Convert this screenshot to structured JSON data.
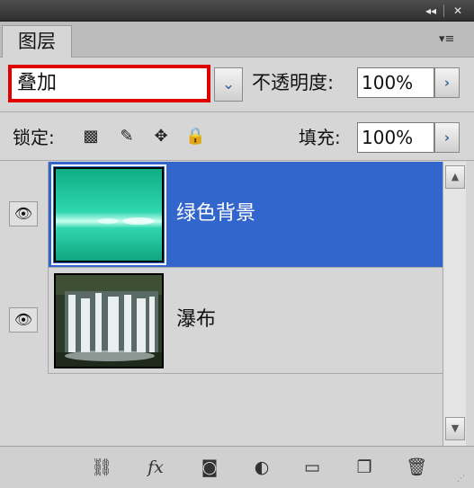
{
  "titlebar": {
    "collapse_glyph": "◂◂",
    "close_glyph": "✕"
  },
  "tabs": [
    {
      "label": "图层"
    }
  ],
  "panel_menu_glyph": "▾≡",
  "blend": {
    "value": "叠加",
    "dropdown_glyph": "⌄"
  },
  "opacity": {
    "label": "不透明度:",
    "value": "100%",
    "arrow_glyph": "›"
  },
  "lock": {
    "label": "锁定:",
    "icons": [
      {
        "name": "lock-transparent-pixels-icon",
        "glyph": "▩"
      },
      {
        "name": "lock-image-pixels-icon",
        "glyph": "✎"
      },
      {
        "name": "lock-position-icon",
        "glyph": "✥"
      },
      {
        "name": "lock-all-icon",
        "glyph": "🔒"
      }
    ]
  },
  "fill": {
    "label": "填充:",
    "value": "100%",
    "arrow_glyph": "›"
  },
  "layers": [
    {
      "name": "绿色背景",
      "visible": true,
      "selected": true,
      "thumbnail": "teal-gradient"
    },
    {
      "name": "瀑布",
      "visible": true,
      "selected": false,
      "thumbnail": "waterfall-photo"
    }
  ],
  "eye_glyph": "👁",
  "scrollbar": {
    "up_glyph": "▲",
    "down_glyph": "▼"
  },
  "bottom_toolbar": [
    {
      "name": "link-layers-icon",
      "glyph": "⛓"
    },
    {
      "name": "layer-style-fx-icon",
      "glyph": "fx"
    },
    {
      "name": "add-mask-icon",
      "glyph": "◙"
    },
    {
      "name": "adjustment-layer-icon",
      "glyph": "◐"
    },
    {
      "name": "new-group-folder-icon",
      "glyph": "▭"
    },
    {
      "name": "new-layer-icon",
      "glyph": "❐"
    },
    {
      "name": "delete-layer-trash-icon",
      "glyph": "🗑"
    }
  ],
  "colors": {
    "selection": "#3366cc",
    "highlight_border": "#e00000",
    "teal": "#1fc8a0"
  }
}
